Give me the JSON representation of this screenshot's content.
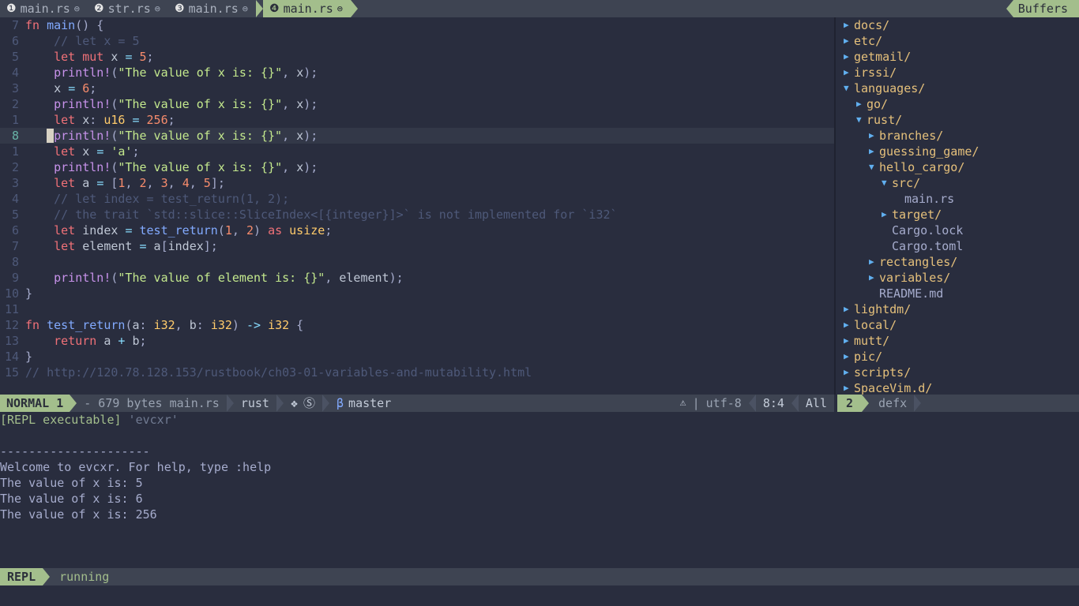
{
  "tabline": {
    "tabs": [
      {
        "num": "❶",
        "label": "main.rs",
        "modified_icon": "⊜"
      },
      {
        "num": "❷",
        "label": "str.rs",
        "modified_icon": "⊜"
      },
      {
        "num": "❸",
        "label": "main.rs",
        "modified_icon": "⊜"
      },
      {
        "num": "❹",
        "label": "main.rs",
        "modified_icon": "⊜"
      }
    ],
    "active_index": 3,
    "buffers_label": "Buffers"
  },
  "editor": {
    "lines": [
      {
        "lnum": "7",
        "cursor": false,
        "tokens": [
          {
            "c": "kw",
            "t": "fn"
          },
          {
            "c": "pun",
            "t": " "
          },
          {
            "c": "fn",
            "t": "main"
          },
          {
            "c": "pun",
            "t": "() {"
          }
        ]
      },
      {
        "lnum": "6",
        "cursor": false,
        "tokens": [
          {
            "c": "com",
            "t": "    // let x = 5"
          }
        ]
      },
      {
        "lnum": "5",
        "cursor": false,
        "tokens": [
          {
            "c": "pun",
            "t": "    "
          },
          {
            "c": "kw",
            "t": "let"
          },
          {
            "c": "pun",
            "t": " "
          },
          {
            "c": "kw",
            "t": "mut"
          },
          {
            "c": "var",
            "t": " x "
          },
          {
            "c": "op",
            "t": "="
          },
          {
            "c": "num_",
            "t": " 5"
          },
          {
            "c": "pun",
            "t": ";"
          }
        ]
      },
      {
        "lnum": "4",
        "cursor": false,
        "tokens": [
          {
            "c": "pun",
            "t": "    "
          },
          {
            "c": "mac",
            "t": "println!"
          },
          {
            "c": "pun",
            "t": "("
          },
          {
            "c": "str",
            "t": "\"The value of x is: {}\""
          },
          {
            "c": "pun",
            "t": ", "
          },
          {
            "c": "var",
            "t": "x"
          },
          {
            "c": "pun",
            "t": ");"
          }
        ]
      },
      {
        "lnum": "3",
        "cursor": false,
        "tokens": [
          {
            "c": "var",
            "t": "    x "
          },
          {
            "c": "op",
            "t": "="
          },
          {
            "c": "num_",
            "t": " 6"
          },
          {
            "c": "pun",
            "t": ";"
          }
        ]
      },
      {
        "lnum": "2",
        "cursor": false,
        "tokens": [
          {
            "c": "pun",
            "t": "    "
          },
          {
            "c": "mac",
            "t": "println!"
          },
          {
            "c": "pun",
            "t": "("
          },
          {
            "c": "str",
            "t": "\"The value of x is: {}\""
          },
          {
            "c": "pun",
            "t": ", "
          },
          {
            "c": "var",
            "t": "x"
          },
          {
            "c": "pun",
            "t": ");"
          }
        ]
      },
      {
        "lnum": "1",
        "cursor": false,
        "tokens": [
          {
            "c": "pun",
            "t": "    "
          },
          {
            "c": "kw",
            "t": "let"
          },
          {
            "c": "var",
            "t": " x"
          },
          {
            "c": "pun",
            "t": ": "
          },
          {
            "c": "typ",
            "t": "u16"
          },
          {
            "c": "pun",
            "t": " "
          },
          {
            "c": "op",
            "t": "="
          },
          {
            "c": "num_",
            "t": " 256"
          },
          {
            "c": "pun",
            "t": ";"
          }
        ]
      },
      {
        "lnum": "8",
        "cursor": true,
        "tokens": [
          {
            "c": "pun",
            "t": "    "
          },
          {
            "c": "mac",
            "t": "println!"
          },
          {
            "c": "pun",
            "t": "("
          },
          {
            "c": "str",
            "t": "\"The value of x is: {}\""
          },
          {
            "c": "pun",
            "t": ", "
          },
          {
            "c": "var",
            "t": "x"
          },
          {
            "c": "pun",
            "t": ");"
          }
        ]
      },
      {
        "lnum": "1",
        "cursor": false,
        "tokens": [
          {
            "c": "pun",
            "t": "    "
          },
          {
            "c": "kw",
            "t": "let"
          },
          {
            "c": "var",
            "t": " x "
          },
          {
            "c": "op",
            "t": "="
          },
          {
            "c": "pun",
            "t": " "
          },
          {
            "c": "str",
            "t": "'a'"
          },
          {
            "c": "pun",
            "t": ";"
          }
        ]
      },
      {
        "lnum": "2",
        "cursor": false,
        "tokens": [
          {
            "c": "pun",
            "t": "    "
          },
          {
            "c": "mac",
            "t": "println!"
          },
          {
            "c": "pun",
            "t": "("
          },
          {
            "c": "str",
            "t": "\"The value of x is: {}\""
          },
          {
            "c": "pun",
            "t": ", "
          },
          {
            "c": "var",
            "t": "x"
          },
          {
            "c": "pun",
            "t": ");"
          }
        ]
      },
      {
        "lnum": "3",
        "cursor": false,
        "tokens": [
          {
            "c": "pun",
            "t": "    "
          },
          {
            "c": "kw",
            "t": "let"
          },
          {
            "c": "var",
            "t": " a "
          },
          {
            "c": "op",
            "t": "="
          },
          {
            "c": "pun",
            "t": " ["
          },
          {
            "c": "num_",
            "t": "1"
          },
          {
            "c": "pun",
            "t": ", "
          },
          {
            "c": "num_",
            "t": "2"
          },
          {
            "c": "pun",
            "t": ", "
          },
          {
            "c": "num_",
            "t": "3"
          },
          {
            "c": "pun",
            "t": ", "
          },
          {
            "c": "num_",
            "t": "4"
          },
          {
            "c": "pun",
            "t": ", "
          },
          {
            "c": "num_",
            "t": "5"
          },
          {
            "c": "pun",
            "t": "];"
          }
        ]
      },
      {
        "lnum": "4",
        "cursor": false,
        "tokens": [
          {
            "c": "com",
            "t": "    // let index = test_return(1, 2);"
          }
        ]
      },
      {
        "lnum": "5",
        "cursor": false,
        "tokens": [
          {
            "c": "com",
            "t": "    // the trait `std::slice::SliceIndex<[{integer}]>` is not implemented for `i32`"
          }
        ]
      },
      {
        "lnum": "6",
        "cursor": false,
        "tokens": [
          {
            "c": "pun",
            "t": "    "
          },
          {
            "c": "kw",
            "t": "let"
          },
          {
            "c": "var",
            "t": " index "
          },
          {
            "c": "op",
            "t": "="
          },
          {
            "c": "pun",
            "t": " "
          },
          {
            "c": "fn",
            "t": "test_return"
          },
          {
            "c": "pun",
            "t": "("
          },
          {
            "c": "num_",
            "t": "1"
          },
          {
            "c": "pun",
            "t": ", "
          },
          {
            "c": "num_",
            "t": "2"
          },
          {
            "c": "pun",
            "t": ") "
          },
          {
            "c": "kw",
            "t": "as"
          },
          {
            "c": "pun",
            "t": " "
          },
          {
            "c": "typ",
            "t": "usize"
          },
          {
            "c": "pun",
            "t": ";"
          }
        ]
      },
      {
        "lnum": "7",
        "cursor": false,
        "tokens": [
          {
            "c": "pun",
            "t": "    "
          },
          {
            "c": "kw",
            "t": "let"
          },
          {
            "c": "var",
            "t": " element "
          },
          {
            "c": "op",
            "t": "="
          },
          {
            "c": "var",
            "t": " a"
          },
          {
            "c": "pun",
            "t": "["
          },
          {
            "c": "var",
            "t": "index"
          },
          {
            "c": "pun",
            "t": "];"
          }
        ]
      },
      {
        "lnum": "8",
        "cursor": false,
        "tokens": [
          {
            "c": "pun",
            "t": ""
          }
        ]
      },
      {
        "lnum": "9",
        "cursor": false,
        "tokens": [
          {
            "c": "pun",
            "t": "    "
          },
          {
            "c": "mac",
            "t": "println!"
          },
          {
            "c": "pun",
            "t": "("
          },
          {
            "c": "str",
            "t": "\"The value of element is: {}\""
          },
          {
            "c": "pun",
            "t": ", "
          },
          {
            "c": "var",
            "t": "element"
          },
          {
            "c": "pun",
            "t": ");"
          }
        ]
      },
      {
        "lnum": "10",
        "cursor": false,
        "tokens": [
          {
            "c": "pun",
            "t": "}"
          }
        ]
      },
      {
        "lnum": "11",
        "cursor": false,
        "tokens": [
          {
            "c": "pun",
            "t": ""
          }
        ]
      },
      {
        "lnum": "12",
        "cursor": false,
        "tokens": [
          {
            "c": "kw",
            "t": "fn"
          },
          {
            "c": "pun",
            "t": " "
          },
          {
            "c": "fn",
            "t": "test_return"
          },
          {
            "c": "pun",
            "t": "("
          },
          {
            "c": "var",
            "t": "a"
          },
          {
            "c": "pun",
            "t": ": "
          },
          {
            "c": "typ",
            "t": "i32"
          },
          {
            "c": "pun",
            "t": ", "
          },
          {
            "c": "var",
            "t": "b"
          },
          {
            "c": "pun",
            "t": ": "
          },
          {
            "c": "typ",
            "t": "i32"
          },
          {
            "c": "pun",
            "t": ") "
          },
          {
            "c": "op",
            "t": "->"
          },
          {
            "c": "pun",
            "t": " "
          },
          {
            "c": "typ",
            "t": "i32"
          },
          {
            "c": "pun",
            "t": " {"
          }
        ]
      },
      {
        "lnum": "13",
        "cursor": false,
        "tokens": [
          {
            "c": "pun",
            "t": "    "
          },
          {
            "c": "kw",
            "t": "return"
          },
          {
            "c": "var",
            "t": " a "
          },
          {
            "c": "op",
            "t": "+"
          },
          {
            "c": "var",
            "t": " b"
          },
          {
            "c": "pun",
            "t": ";"
          }
        ]
      },
      {
        "lnum": "14",
        "cursor": false,
        "tokens": [
          {
            "c": "pun",
            "t": "}"
          }
        ]
      },
      {
        "lnum": "15",
        "cursor": false,
        "tokens": [
          {
            "c": "com",
            "t": "// http://120.78.128.153/rustbook/ch03-01-variables-and-mutability.html"
          }
        ]
      }
    ]
  },
  "tree": {
    "rows": [
      {
        "indent": 0,
        "marker": "collapsed",
        "name": "docs/",
        "kind": "dir"
      },
      {
        "indent": 0,
        "marker": "collapsed",
        "name": "etc/",
        "kind": "dir"
      },
      {
        "indent": 0,
        "marker": "collapsed",
        "name": "getmail/",
        "kind": "dir"
      },
      {
        "indent": 0,
        "marker": "collapsed",
        "name": "irssi/",
        "kind": "dir"
      },
      {
        "indent": 0,
        "marker": "expanded",
        "name": "languages/",
        "kind": "dir"
      },
      {
        "indent": 1,
        "marker": "collapsed",
        "name": "go/",
        "kind": "dir"
      },
      {
        "indent": 1,
        "marker": "expanded",
        "name": "rust/",
        "kind": "dir"
      },
      {
        "indent": 2,
        "marker": "collapsed",
        "name": "branches/",
        "kind": "dir"
      },
      {
        "indent": 2,
        "marker": "collapsed",
        "name": "guessing_game/",
        "kind": "dir"
      },
      {
        "indent": 2,
        "marker": "expanded",
        "name": "hello_cargo/",
        "kind": "dir"
      },
      {
        "indent": 3,
        "marker": "expanded",
        "name": "src/",
        "kind": "dir"
      },
      {
        "indent": 4,
        "marker": "none",
        "name": "main.rs",
        "kind": "file"
      },
      {
        "indent": 3,
        "marker": "collapsed",
        "name": "target/",
        "kind": "dir"
      },
      {
        "indent": 3,
        "marker": "none",
        "name": "Cargo.lock",
        "kind": "file"
      },
      {
        "indent": 3,
        "marker": "none",
        "name": "Cargo.toml",
        "kind": "file"
      },
      {
        "indent": 2,
        "marker": "collapsed",
        "name": "rectangles/",
        "kind": "dir"
      },
      {
        "indent": 2,
        "marker": "collapsed",
        "name": "variables/",
        "kind": "dir"
      },
      {
        "indent": 2,
        "marker": "none",
        "name": "README.md",
        "kind": "file"
      },
      {
        "indent": 0,
        "marker": "collapsed",
        "name": "lightdm/",
        "kind": "dir"
      },
      {
        "indent": 0,
        "marker": "collapsed",
        "name": "local/",
        "kind": "dir"
      },
      {
        "indent": 0,
        "marker": "collapsed",
        "name": "mutt/",
        "kind": "dir"
      },
      {
        "indent": 0,
        "marker": "collapsed",
        "name": "pic/",
        "kind": "dir"
      },
      {
        "indent": 0,
        "marker": "collapsed",
        "name": "scripts/",
        "kind": "dir"
      },
      {
        "indent": 0,
        "marker": "collapsed",
        "name": "SpaceVim.d/",
        "kind": "dir"
      }
    ],
    "marker_expanded": "▼",
    "marker_collapsed": "▶"
  },
  "statusline": {
    "mode": "NORMAL 1",
    "file_info": "- 679 bytes main.rs",
    "filetype": "rust",
    "icon_diamond": "❖",
    "icon_circle_s": "Ⓢ",
    "icon_branch": "β",
    "branch": "master",
    "icon_os": "⚠",
    "separator": "|",
    "encoding": "utf-8",
    "position": "8:4",
    "percent": "All"
  },
  "tree_statusline": {
    "window_number": "2",
    "name": "defx"
  },
  "repl": {
    "lines": [
      {
        "tag": "[REPL executable]",
        "dim": " 'evcxr'"
      },
      {
        "tag": "",
        "dim": ""
      },
      {
        "tag": "",
        "text": "---------------------"
      },
      {
        "tag": "",
        "text": "Welcome to evcxr. For help, type :help"
      },
      {
        "tag": "",
        "text": "The value of x is: 5"
      },
      {
        "tag": "",
        "text": "The value of x is: 6"
      },
      {
        "tag": "",
        "text": "The value of x is: 256"
      }
    ]
  },
  "repl_status": {
    "badge": "REPL",
    "state": "running"
  },
  "colors": {
    "bg": "#292d3e",
    "statusbar_bg": "#3e4452",
    "accent_green": "#a3be8c",
    "dir": "#e5c07b",
    "file": "#a6accd",
    "marker_blue": "#61afef",
    "cursorline": "#333848"
  }
}
